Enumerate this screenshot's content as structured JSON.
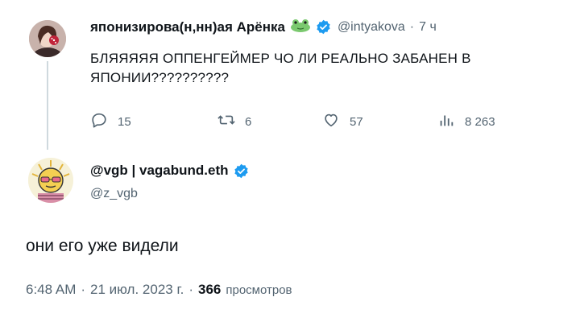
{
  "parent_tweet": {
    "display_name": "японизирова(н,нн)ая Арёнка",
    "handle": "@intyakova",
    "separator": "·",
    "time": "7 ч",
    "text_line1": "БЛЯЯЯЯЯ ОППЕНГЕЙМЕР ЧО ЛИ РЕАЛЬНО ЗАБАНЕН В",
    "text_line2": "ЯПОНИИ??????????",
    "actions": {
      "replies": "15",
      "retweets": "6",
      "likes": "57",
      "views": "8 263"
    }
  },
  "reply_tweet": {
    "display_name": "@vgb | vagabund.eth",
    "handle": "@z_vgb",
    "text": "они его уже видели",
    "time": "6:48 AM",
    "separator1": "·",
    "date": "21 июл. 2023 г.",
    "separator2": "·",
    "views_count": "366",
    "views_label": "просмотров"
  },
  "colors": {
    "verified": "#1d9bf0",
    "frog": "#7bc96f",
    "muted": "#536471"
  },
  "icons": [
    "frog-emoji-icon",
    "verified-badge-icon",
    "reply-icon",
    "retweet-icon",
    "like-icon",
    "views-icon"
  ]
}
